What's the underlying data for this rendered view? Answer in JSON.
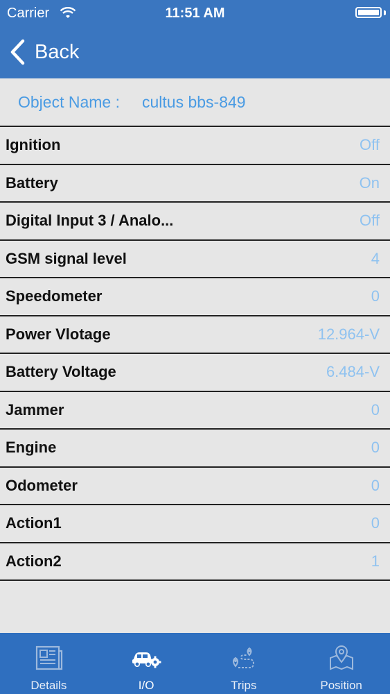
{
  "status": {
    "carrier": "Carrier",
    "time": "11:51 AM"
  },
  "nav": {
    "back_label": "Back"
  },
  "object": {
    "label": "Object Name :",
    "value": "cultus bbs-849"
  },
  "rows": [
    {
      "label": "Ignition",
      "value": "Off"
    },
    {
      "label": "Battery",
      "value": "On"
    },
    {
      "label": "Digital Input 3 / Analo...",
      "value": "Off"
    },
    {
      "label": "GSM signal level",
      "value": "4"
    },
    {
      "label": "Speedometer",
      "value": "0"
    },
    {
      "label": "Power Vlotage",
      "value": "12.964-V"
    },
    {
      "label": "Battery Voltage",
      "value": "6.484-V"
    },
    {
      "label": "Jammer",
      "value": "0"
    },
    {
      "label": "Engine",
      "value": "0"
    },
    {
      "label": "Odometer",
      "value": "0"
    },
    {
      "label": "Action1",
      "value": "0"
    },
    {
      "label": "Action2",
      "value": "1"
    }
  ],
  "tabs": [
    {
      "label": "Details",
      "icon": "newspaper-icon"
    },
    {
      "label": "I/O",
      "icon": "car-gear-icon",
      "selected": true
    },
    {
      "label": "Trips",
      "icon": "route-icon"
    },
    {
      "label": "Position",
      "icon": "map-pin-icon"
    }
  ],
  "colors": {
    "header": "#3a76c0",
    "accent": "#4a9be3",
    "value": "#8fc2f0",
    "tabbar": "#2f6fbf"
  }
}
